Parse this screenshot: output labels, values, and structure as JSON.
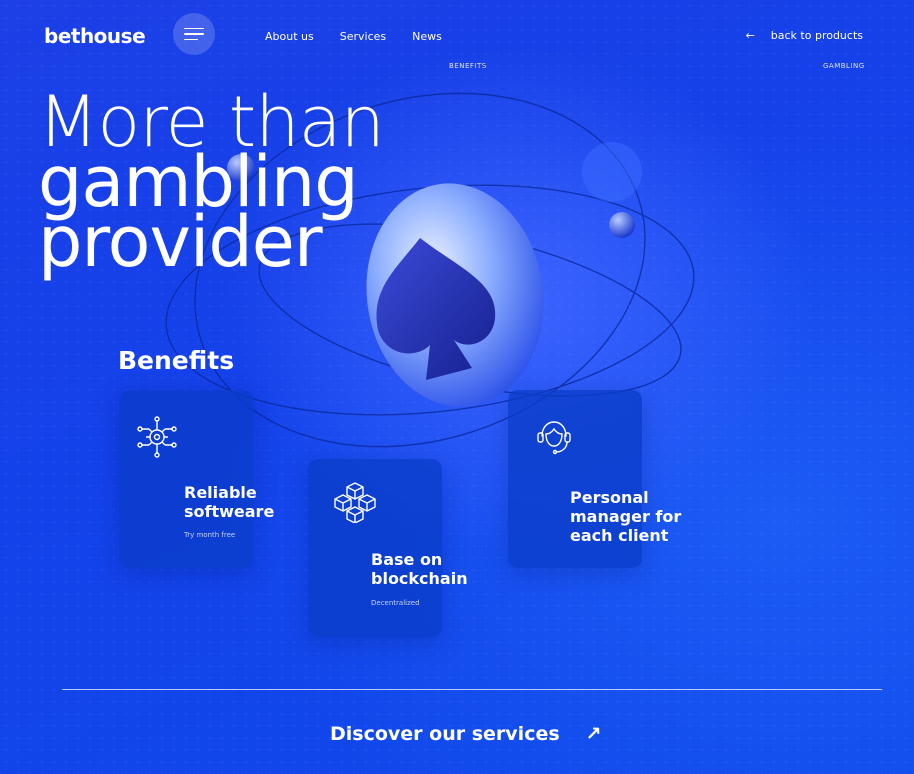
{
  "header": {
    "logo": "bethouse",
    "nav": [
      "About us",
      "Services",
      "News"
    ],
    "back_arrow": "←",
    "back_label": "back to products",
    "tag_benefits": "BENEFITS",
    "tag_gambling": "GAMBLING"
  },
  "hero": {
    "line1": "More than",
    "line2": "gambling",
    "line3": "provider"
  },
  "benefits": {
    "title": "Benefits",
    "cards": [
      {
        "icon": "cog-circuit-icon",
        "title_line1": "Reliable",
        "title_line2": "softweare",
        "subtitle": "Try month free"
      },
      {
        "icon": "blockchain-cubes-icon",
        "title_line1": "Base on",
        "title_line2": "blockchain",
        "subtitle": "Decentralized"
      },
      {
        "icon": "headset-icon",
        "title_line1": "Personal",
        "title_line2": "manager for",
        "title_line3": "each client"
      }
    ]
  },
  "footer": {
    "cta": "Discover our services",
    "cta_arrow": "↗"
  },
  "colors": {
    "background": "#1442ea",
    "card": "#0a3cc8",
    "text": "#ffffff"
  }
}
